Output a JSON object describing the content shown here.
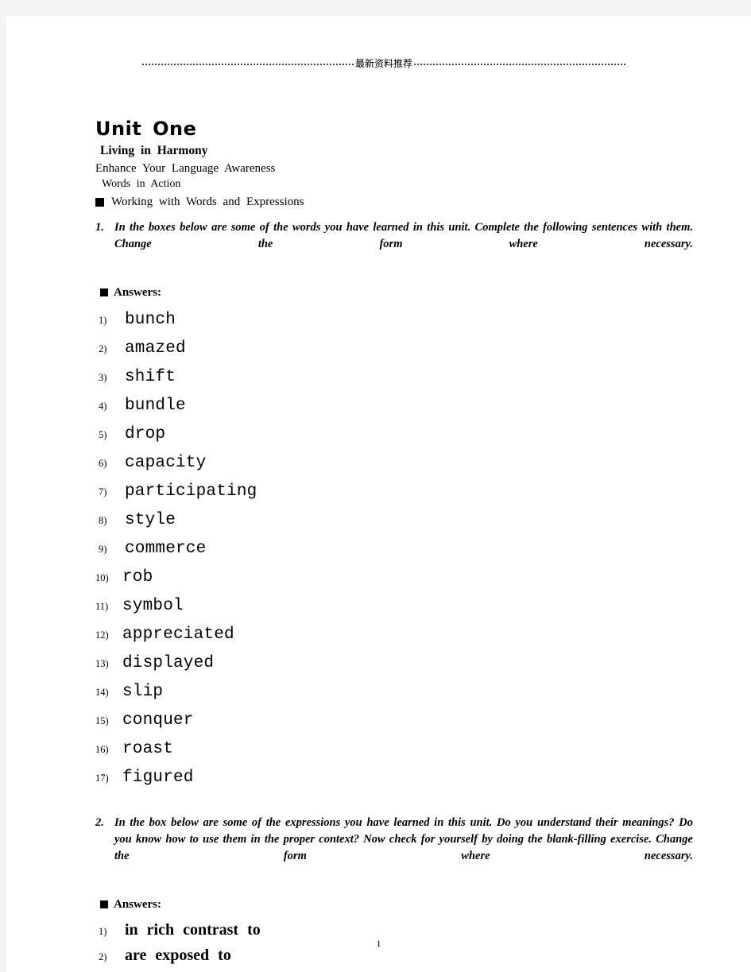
{
  "header": {
    "title": "最新资料推荐",
    "leader_style": "dotted"
  },
  "document": {
    "unit_title": "Unit  One",
    "section_title": "Living  in  Harmony",
    "sub_lines": [
      "Enhance  Your  Language  Awareness",
      "Words  in  Action"
    ],
    "marker_heading": "Working  with  Words  and  Expressions"
  },
  "exercise1": {
    "number": "1.",
    "instruction": "In the boxes below are some of the words you have learned in this unit. Complete the following sentences with them. Change the form where necessary.",
    "answers_label": "Answers:",
    "answers": [
      {
        "index": "1)",
        "word": "bunch"
      },
      {
        "index": "2)",
        "word": "amazed"
      },
      {
        "index": "3)",
        "word": "shift"
      },
      {
        "index": "4)",
        "word": "bundle"
      },
      {
        "index": "5)",
        "word": "drop"
      },
      {
        "index": "6)",
        "word": "capacity"
      },
      {
        "index": "7)",
        "word": "participating"
      },
      {
        "index": "8)",
        "word": "style"
      },
      {
        "index": "9)",
        "word": "commerce"
      },
      {
        "index": "10)",
        "word": "rob"
      },
      {
        "index": "11)",
        "word": "symbol"
      },
      {
        "index": "12)",
        "word": "appreciated"
      },
      {
        "index": "13)",
        "word": "displayed"
      },
      {
        "index": "14)",
        "word": "slip"
      },
      {
        "index": "15)",
        "word": "conquer"
      },
      {
        "index": "16)",
        "word": "roast"
      },
      {
        "index": "17)",
        "word": "figured"
      }
    ]
  },
  "exercise2": {
    "number": "2.",
    "instruction": "In the box below are some of the expressions you have learned in this unit. Do you understand their meanings? Do you know how to use them in the proper context? Now check for yourself by doing the blank-filling exercise. Change the form where necessary.",
    "answers_label": "Answers:",
    "answers": [
      {
        "index": "1)",
        "phrase": "in  rich  contrast  to"
      },
      {
        "index": "2)",
        "phrase": "are  exposed  to"
      }
    ]
  },
  "footer": {
    "page_number": "1"
  },
  "colors": {
    "backdrop": "#f4f4f4",
    "page": "#ffffff",
    "text": "#000000"
  }
}
